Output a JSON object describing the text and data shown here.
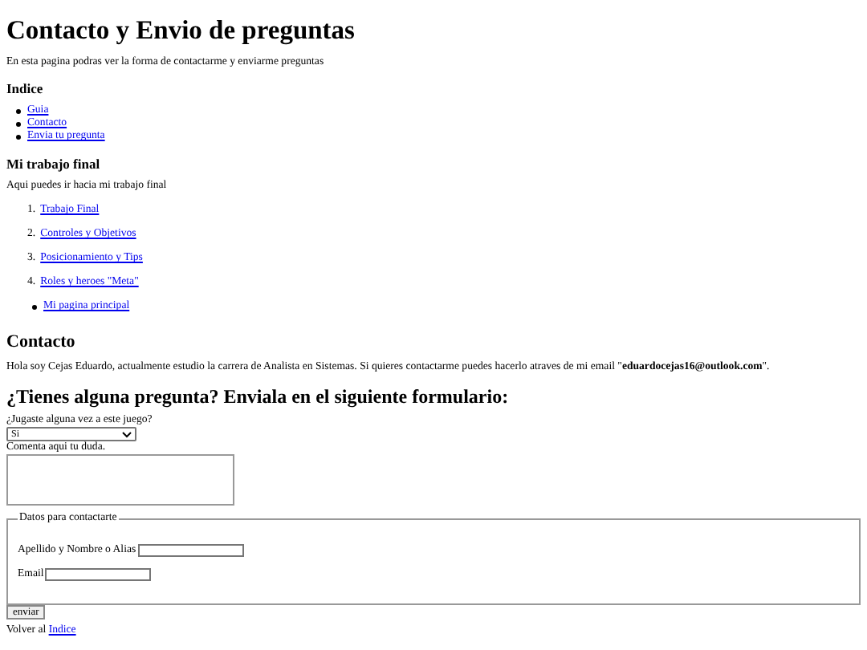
{
  "title": "Contacto y Envio de preguntas",
  "intro": "En esta pagina podras ver la forma de contactarme y enviarme preguntas",
  "index": {
    "heading": "Indice",
    "links": [
      "Guia",
      "Contacto",
      "Envia tu pregunta"
    ]
  },
  "final_work": {
    "heading": "Mi trabajo final",
    "text": "Aqui puedes ir hacia mi trabajo final",
    "numbered_links": [
      {
        "number": "1.",
        "label": "Trabajo Final"
      },
      {
        "number": "2.",
        "label": "Controles y Objetivos"
      },
      {
        "number": "3.",
        "label": "Posicionamiento y Tips"
      },
      {
        "number": "4.",
        "label": "Roles y heroes \"Meta\""
      }
    ],
    "bullet_links": [
      "Mi pagina principal"
    ]
  },
  "contact": {
    "heading": "Contacto",
    "text": "Hola soy Cejas Eduardo, actualmente estudio la carrera de Analista en Sistemas. Si quieres contactarme puedes hacerlo atraves de mi email \"**eduardocejas16@outlook.com**\"."
  },
  "form": {
    "heading": "¿Tienes alguna pregunta? Enviala en el siguiente formulario:",
    "question_label": "¿Jugaste alguna vez a este juego?",
    "question_value": "Si",
    "comment_label": "Comenta aqui tu duda.",
    "fieldset": {
      "legend": "Datos para contactarte",
      "fields": [
        {
          "label": "Apellido y Nombre o Alias"
        },
        {
          "label": "Email"
        }
      ]
    },
    "submit": "enviar"
  },
  "footer": {
    "text": "Volver al",
    "link": "Indice"
  }
}
